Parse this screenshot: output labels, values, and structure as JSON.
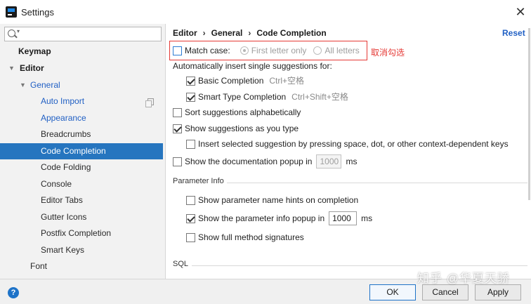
{
  "window": {
    "title": "Settings",
    "close_glyph": "✕"
  },
  "sidebar": {
    "search_placeholder": "",
    "items": [
      {
        "label": "Keymap"
      },
      {
        "label": "Editor"
      },
      {
        "label": "General"
      },
      {
        "label": "Auto Import"
      },
      {
        "label": "Appearance"
      },
      {
        "label": "Breadcrumbs"
      },
      {
        "label": "Code Completion"
      },
      {
        "label": "Code Folding"
      },
      {
        "label": "Console"
      },
      {
        "label": "Editor Tabs"
      },
      {
        "label": "Gutter Icons"
      },
      {
        "label": "Postfix Completion"
      },
      {
        "label": "Smart Keys"
      },
      {
        "label": "Font"
      }
    ],
    "selected": "Code Completion"
  },
  "header": {
    "breadcrumb": [
      "Editor",
      "General",
      "Code Completion"
    ],
    "breadcrumb_sep": "›",
    "reset_label": "Reset"
  },
  "annotation": {
    "text": "取消勾选",
    "color": "#e53935"
  },
  "options": {
    "match_case": {
      "label": "Match case:",
      "checked": false
    },
    "first_letter_only": {
      "label": "First letter only",
      "selected": true,
      "enabled": false
    },
    "all_letters": {
      "label": "All letters",
      "selected": false,
      "enabled": false
    },
    "auto_insert_heading": "Automatically insert single suggestions for:",
    "basic_completion": {
      "label": "Basic Completion",
      "shortcut": "Ctrl+空格",
      "checked": true
    },
    "smart_type_completion": {
      "label": "Smart Type Completion",
      "shortcut": "Ctrl+Shift+空格",
      "checked": true
    },
    "sort_alphabetically": {
      "label": "Sort suggestions alphabetically",
      "checked": false
    },
    "show_as_you_type": {
      "label": "Show suggestions as you type",
      "checked": true
    },
    "insert_selected": {
      "label": "Insert selected suggestion by pressing space, dot, or other context-dependent keys",
      "checked": false
    },
    "show_doc_popup": {
      "label": "Show the documentation popup in",
      "value": "1000",
      "unit": "ms",
      "checked": false
    }
  },
  "parameter_info": {
    "section_title": "Parameter Info",
    "name_hints": {
      "label": "Show parameter name hints on completion",
      "checked": false
    },
    "info_popup": {
      "label": "Show the parameter info popup in",
      "value": "1000",
      "unit": "ms",
      "checked": true
    },
    "full_signatures": {
      "label": "Show full method signatures",
      "checked": false
    }
  },
  "sql": {
    "section_title": "SQL"
  },
  "footer": {
    "help_glyph": "?",
    "ok_label": "OK",
    "cancel_label": "Cancel",
    "apply_label": "Apply"
  },
  "watermark": {
    "text": "知乎 @华夏天骄"
  },
  "colors": {
    "accent": "#2675bf",
    "link": "#2160c4",
    "annotation": "#e53935"
  }
}
